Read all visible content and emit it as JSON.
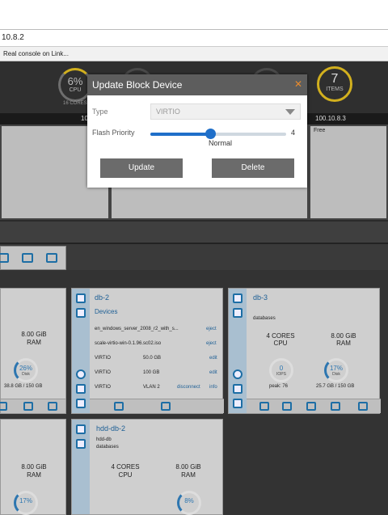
{
  "browser": {
    "address": "10.8.2",
    "console_link": "Real console on Link..."
  },
  "header": {
    "cpu_value": "6%",
    "cpu_label": "CPU",
    "cores_label": "16 CORES",
    "items_value": "7",
    "items_label": "ITEMS"
  },
  "nodes": {
    "node1": "10.8",
    "node3": "100.10.8.3",
    "free": "Free"
  },
  "modal": {
    "title": "Update Block Device",
    "type_label": "Type",
    "type_value": "VIRTIO",
    "flash_label": "Flash Priority",
    "flash_value": "4",
    "flash_level_fraction": 0.44,
    "flash_desc": "Normal",
    "update_label": "Update",
    "delete_label": "Delete"
  },
  "cards": {
    "left_top": {
      "ram_value": "8.00 GiB",
      "ram_label": "RAM",
      "disk_pct": "26%",
      "disk_label": "Disk",
      "disk_usage": "38.8 GB / 150 GB"
    },
    "db2": {
      "name": "db-2",
      "devices_label": "Devices",
      "devices": [
        {
          "name": "en_windows_server_2008_r2_with_s...",
          "action": "eject"
        },
        {
          "name": "scale-virtio-win-0.1.96.sc02.iso",
          "action": "eject"
        },
        {
          "name": "VIRTIO",
          "size": "50.0 GB",
          "action": "edit"
        },
        {
          "name": "VIRTIO",
          "size": "100 GB",
          "action": "edit"
        },
        {
          "name": "VIRTIO",
          "size": "VLAN 2",
          "action": "disconnect",
          "action2": "info"
        }
      ]
    },
    "db3": {
      "name": "db-3",
      "desc": "databases",
      "cores_value": "4 CORES",
      "cores_label": "CPU",
      "ram_value": "8.00 GiB",
      "ram_label": "RAM",
      "iops_value": "0",
      "iops_label": "IOPS",
      "iops_peak": "peak: 76",
      "disk_pct": "17%",
      "disk_label": "Disk",
      "disk_usage": "25.7 GB / 150 GB"
    },
    "left_bottom": {
      "ram_value": "8.00 GiB",
      "ram_label": "RAM",
      "disk_pct": "17%"
    },
    "hdd": {
      "name": "hdd-db-2",
      "sub": "hdd-db",
      "desc": "databases",
      "cores_value": "4 CORES",
      "cores_label": "CPU",
      "ram_value": "8.00 GiB",
      "ram_label": "RAM",
      "disk_pct": "8%"
    }
  }
}
